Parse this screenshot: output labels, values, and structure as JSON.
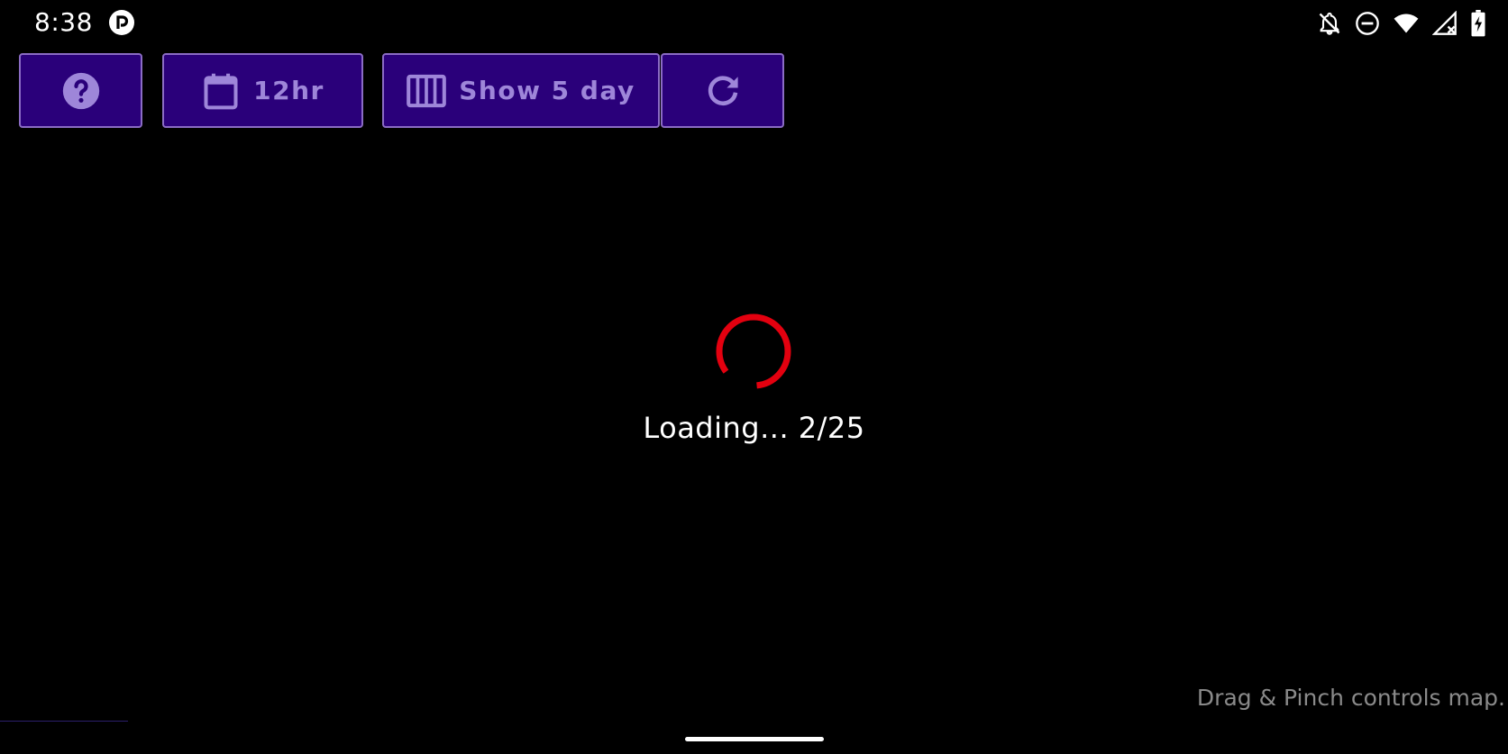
{
  "status_bar": {
    "time": "8:38",
    "icons": [
      "app-notification-icon",
      "notifications-off-icon",
      "do-not-disturb-icon",
      "wifi-icon",
      "cellular-no-signal-icon",
      "battery-charging-icon"
    ]
  },
  "toolbar": {
    "help_icon": "help-circle-icon",
    "time_format_label": "12hr",
    "time_format_icon": "calendar-icon",
    "days_label": "Show 5 day",
    "days_icon": "view-columns-icon",
    "refresh_icon": "refresh-icon"
  },
  "loading": {
    "text": "Loading... 2/25",
    "loaded": 2,
    "total": 25
  },
  "map_hint": "Drag & Pinch controls map.",
  "colors": {
    "background": "#000000",
    "button_fill": "#2a007a",
    "button_border": "#8b6cc4",
    "button_content": "#9e86d9",
    "spinner": "#e3000f",
    "hint_text": "#8a8a8a"
  }
}
